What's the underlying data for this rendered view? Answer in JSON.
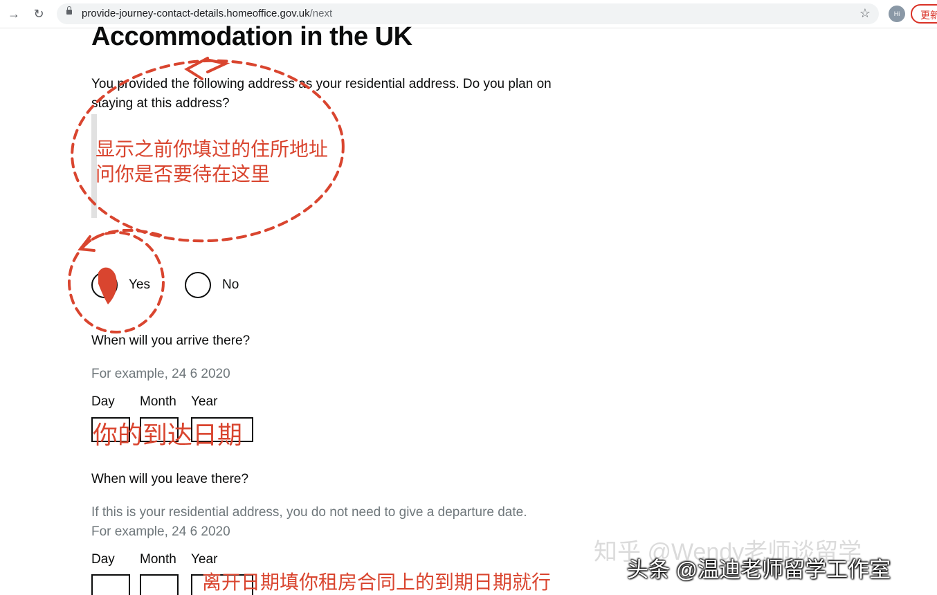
{
  "browser": {
    "url_main": "provide-journey-contact-details.homeoffice.gov.uk",
    "url_path": "/next",
    "avatar_text": "Hi",
    "update_button": "更新"
  },
  "page": {
    "title": "Accommodation in the UK",
    "question": "You provided the following address as your residential address. Do you plan on staying at this address?",
    "options": [
      {
        "label": "Yes",
        "selected": true
      },
      {
        "label": "No",
        "selected": false
      }
    ],
    "arrive": {
      "question": "When will you arrive there?",
      "hint": "For example, 24 6 2020",
      "day_label": "Day",
      "month_label": "Month",
      "year_label": "Year"
    },
    "leave": {
      "question": "When will you leave there?",
      "hint_line1": "If this is your residential address, you do not need to give a departure date.",
      "hint_line2": "For example, 24 6 2020",
      "day_label": "Day",
      "month_label": "Month",
      "year_label": "Year"
    }
  },
  "annotations": {
    "note_address_line1": "显示之前你填过的住所地址",
    "note_address_line2": "问你是否要待在这里",
    "note_arrive": "你的到达日期",
    "note_leave": "离开日期填你租房合同上的到期日期就行",
    "color": "#d9452f"
  },
  "watermarks": {
    "zhihu": "知乎 @Wendy老师谈留学",
    "toutiao": "头条 @温迪老师留学工作室"
  }
}
